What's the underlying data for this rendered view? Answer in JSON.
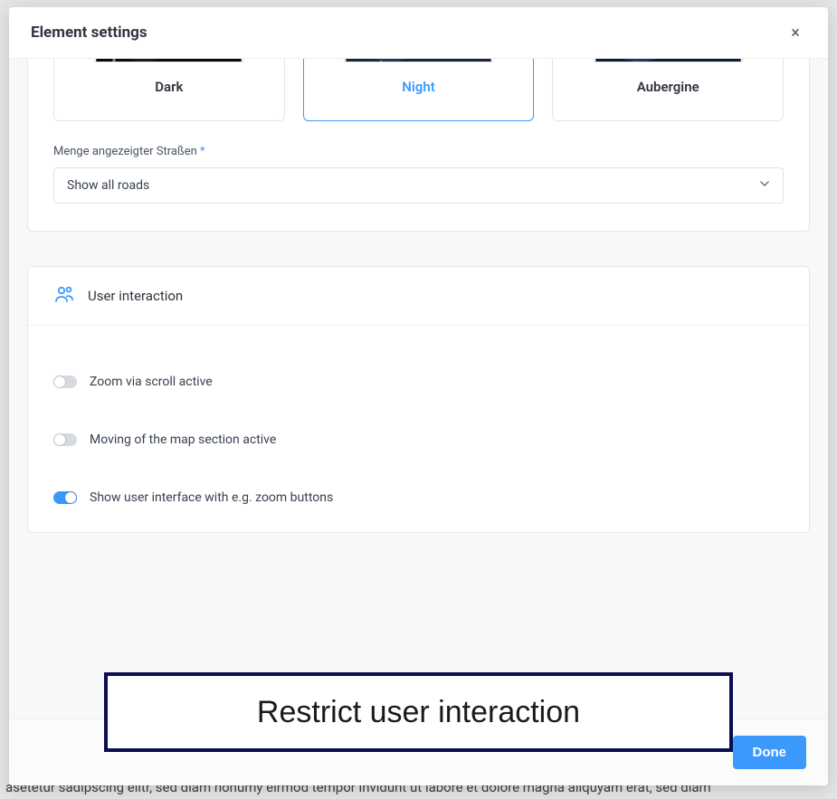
{
  "backdrop_text": "asetetur sadipscing elitr, sed diam nonumy eirmod tempor invidunt ut labore et dolore magna aliquyam erat, sed diam",
  "modal": {
    "title": "Element settings",
    "close_glyph": "×",
    "done_label": "Done"
  },
  "themes": {
    "items": [
      {
        "label": "Dark",
        "selected": false
      },
      {
        "label": "Night",
        "selected": true
      },
      {
        "label": "Aubergine",
        "selected": false
      }
    ],
    "roads_label": "Menge angezeigter Straßen",
    "roads_required": "*",
    "roads_value": "Show all roads"
  },
  "interaction": {
    "section_title": "User interaction",
    "toggles": [
      {
        "label": "Zoom via scroll active",
        "on": false
      },
      {
        "label": "Moving of the map section active",
        "on": false
      },
      {
        "label": "Show user interface with e.g. zoom buttons",
        "on": true
      }
    ]
  },
  "banner_text": "Restrict user interaction"
}
